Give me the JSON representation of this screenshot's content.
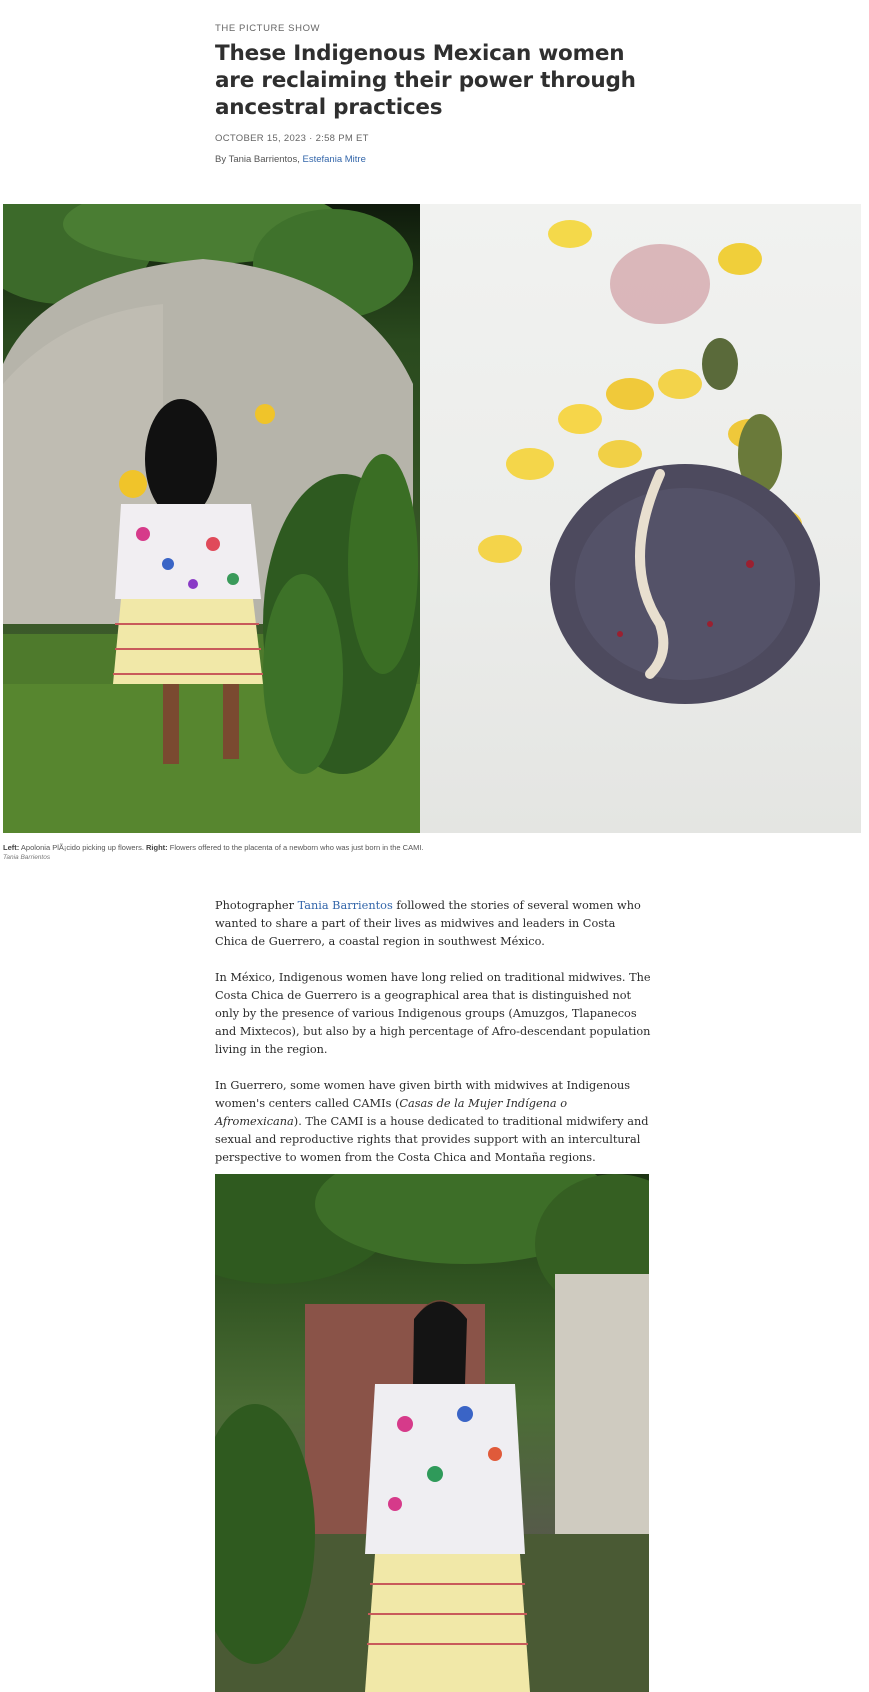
{
  "header": {
    "section": "THE PICTURE SHOW",
    "headline": "These Indigenous Mexican women are reclaiming their power through ancestral practices",
    "dateline": "OCTOBER 15, 2023 · 2:58 PM ET",
    "byline_prefix": "By ",
    "author_1": "Tania Barrientos",
    "separator": ", ",
    "author_2": "Estefania Mitre"
  },
  "lead_image": {
    "caption_left_label": "Left:",
    "caption_left_text": " Apolonia PlÃ¡cido picking up flowers. ",
    "caption_right_label": "Right:",
    "caption_right_text": " Flowers offered to the placenta of a newborn who was just born in the CAMI.",
    "credit": "Tania Barrientos"
  },
  "body": {
    "p1_before": "Photographer ",
    "p1_link": "Tania Barrientos",
    "p1_after": " followed the stories of several women who wanted to share a part of their lives as midwives and leaders in Costa Chica de Guerrero, a coastal region in southwest México.",
    "p2": "In México, Indigenous women have long relied on traditional midwives. The Costa Chica de Guerrero is a geographical area that is distinguished not only by the presence of various Indigenous groups (Amuzgos, Tlapanecos and Mixtecos), but also by a high percentage of Afro-descendant population living in the region.",
    "p3_before": "In Guerrero, some women have given birth with midwives at Indigenous women's centers called CAMIs (",
    "p3_italic": "Casas de la Mujer Indígena o Afromexicana",
    "p3_after": "). The CAMI is a house dedicated to traditional midwifery and sexual and reproductive rights that provides support with an intercultural perspective to women from the Costa Chica and Montaña regions."
  }
}
